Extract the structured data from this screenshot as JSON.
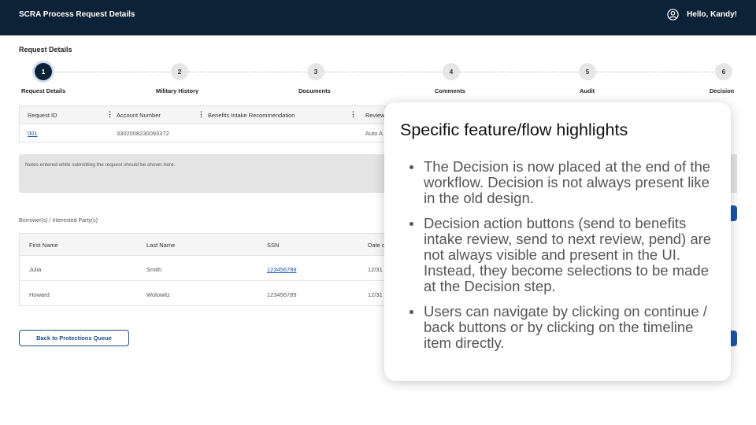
{
  "header": {
    "title": "SCRA Process Request Details",
    "greeting": "Hello, Kandy!",
    "user_icon": "user-circle-icon"
  },
  "section_title": "Request Details",
  "steps": [
    {
      "number": "1",
      "label": "Request Details",
      "active": true
    },
    {
      "number": "2",
      "label": "Military History",
      "active": false
    },
    {
      "number": "3",
      "label": "Documents",
      "active": false
    },
    {
      "number": "4",
      "label": "Comments",
      "active": false
    },
    {
      "number": "5",
      "label": "Audit",
      "active": false
    },
    {
      "number": "6",
      "label": "Decision",
      "active": false
    }
  ],
  "request_table": {
    "headers": [
      "Request ID",
      "Account Number",
      "Benefits Intake Recommendation",
      "Review"
    ],
    "row": [
      "001",
      "3302008230093372",
      "",
      "Auto A"
    ]
  },
  "notes": "Notes entered while submitting the request should be shown here.",
  "borrowers": {
    "label": "Borrower(s) / Interested Party(s)",
    "headers": [
      "First Name",
      "Last Name",
      "SSN",
      "Date o"
    ],
    "rows": [
      [
        "Julia",
        "Smith",
        "123456789",
        "12/31"
      ],
      [
        "Howard",
        "Wolowitz",
        "123456789",
        "12/31"
      ]
    ]
  },
  "back_button": "Back to Protections Queue",
  "callout": {
    "title": "Specific feature/flow highlights",
    "bullets": [
      "The Decision is now placed at the end of the workflow. Decision is not always present like in the old design.",
      "Decision action buttons (send to benefits intake review, send to next review, pend) are not always visible and present in the UI. Instead, they become selections to be made at the Decision step.",
      "Users can navigate by clicking on continue / back buttons or by clicking on the timeline item directly."
    ]
  },
  "colors": {
    "header_bg": "#0c2237",
    "accent": "#1a56b0"
  }
}
